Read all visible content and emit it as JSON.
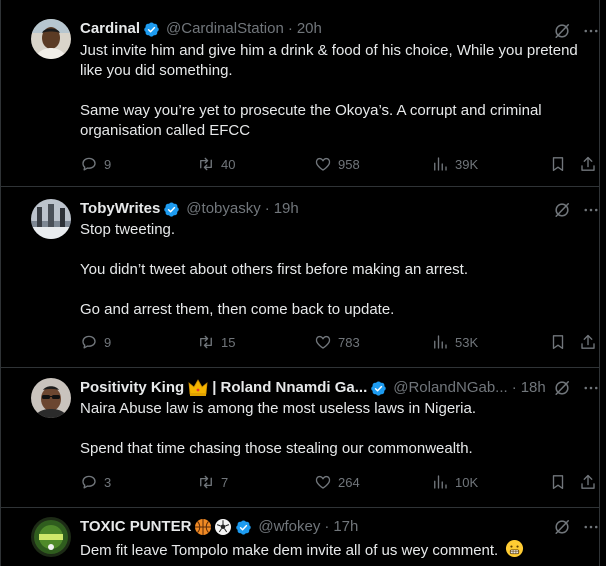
{
  "colors": {
    "background": "#000000",
    "text": "#e7e9ea",
    "secondary": "#71767b",
    "divider": "#2f3336",
    "verified": "#1d9bf0"
  },
  "tweets": [
    {
      "name": "Cardinal",
      "handle": "@CardinalStation",
      "separator": "·",
      "time": "20h",
      "body": [
        "Just invite him and give him a drink & food of his choice, While you pretend like you did something.",
        "Same way you’re yet to prosecute the Okoya’s. A corrupt and criminal organisation called EFCC"
      ],
      "replies": "9",
      "reposts": "40",
      "likes": "958",
      "views": "39K"
    },
    {
      "name": "TobyWrites",
      "handle": "@tobyasky",
      "separator": "·",
      "time": "19h",
      "body": [
        "Stop tweeting.",
        "You didn’t tweet about others first before making an arrest.",
        "Go and arrest them, then come back to update."
      ],
      "replies": "9",
      "reposts": "15",
      "likes": "783",
      "views": "53K"
    },
    {
      "name": "Positivity King",
      "name_suffix": "| Roland Nnamdi Ga...",
      "handle": "@RolandNGab...",
      "separator": "·",
      "time": "18h",
      "name_icons": [
        "crown-emoji"
      ],
      "body": [
        "Naira Abuse law is among the most useless laws in Nigeria.",
        "Spend that time chasing those stealing our commonwealth."
      ],
      "replies": "3",
      "reposts": "7",
      "likes": "264",
      "views": "10K"
    },
    {
      "name": "TOXIC PUNTER",
      "handle": "@wfokey",
      "separator": "·",
      "time": "17h",
      "name_icons": [
        "basketball-emoji",
        "soccer-ball-emoji"
      ],
      "body": [
        "Dem fit leave Tompolo make dem invite all of us wey comment."
      ],
      "body_emoji": "grimacing-face-emoji"
    }
  ]
}
